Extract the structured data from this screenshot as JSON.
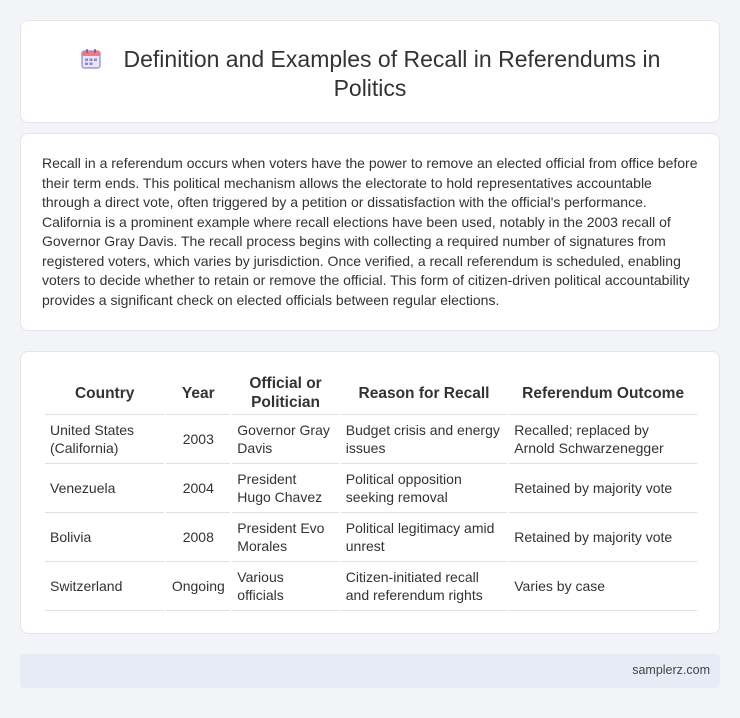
{
  "header": {
    "title": "Definition and Examples of Recall in Referendums in Politics",
    "icon": "calendar-icon"
  },
  "intro": {
    "text": "Recall in a referendum occurs when voters have the power to remove an elected official from office before their term ends. This political mechanism allows the electorate to hold representatives accountable through a direct vote, often triggered by a petition or dissatisfaction with the official's performance. California is a prominent example where recall elections have been used, notably in the 2003 recall of Governor Gray Davis. The recall process begins with collecting a required number of signatures from registered voters, which varies by jurisdiction. Once verified, a recall referendum is scheduled, enabling voters to decide whether to retain or remove the official. This form of citizen-driven political accountability provides a significant check on elected officials between regular elections."
  },
  "table": {
    "headers": [
      "Country",
      "Year",
      "Official or Politician",
      "Reason for Recall",
      "Referendum Outcome"
    ],
    "rows": [
      [
        "United States (California)",
        "2003",
        "Governor Gray Davis",
        "Budget crisis and energy issues",
        "Recalled; replaced by Arnold Schwarzenegger"
      ],
      [
        "Venezuela",
        "2004",
        "President Hugo Chavez",
        "Political opposition seeking removal",
        "Retained by majority vote"
      ],
      [
        "Bolivia",
        "2008",
        "President Evo Morales",
        "Political legitimacy amid unrest",
        "Retained by majority vote"
      ],
      [
        "Switzerland",
        "Ongoing",
        "Various officials",
        "Citizen-initiated recall and referendum rights",
        "Varies by case"
      ]
    ]
  },
  "footer": {
    "text": "samplerz.com"
  }
}
